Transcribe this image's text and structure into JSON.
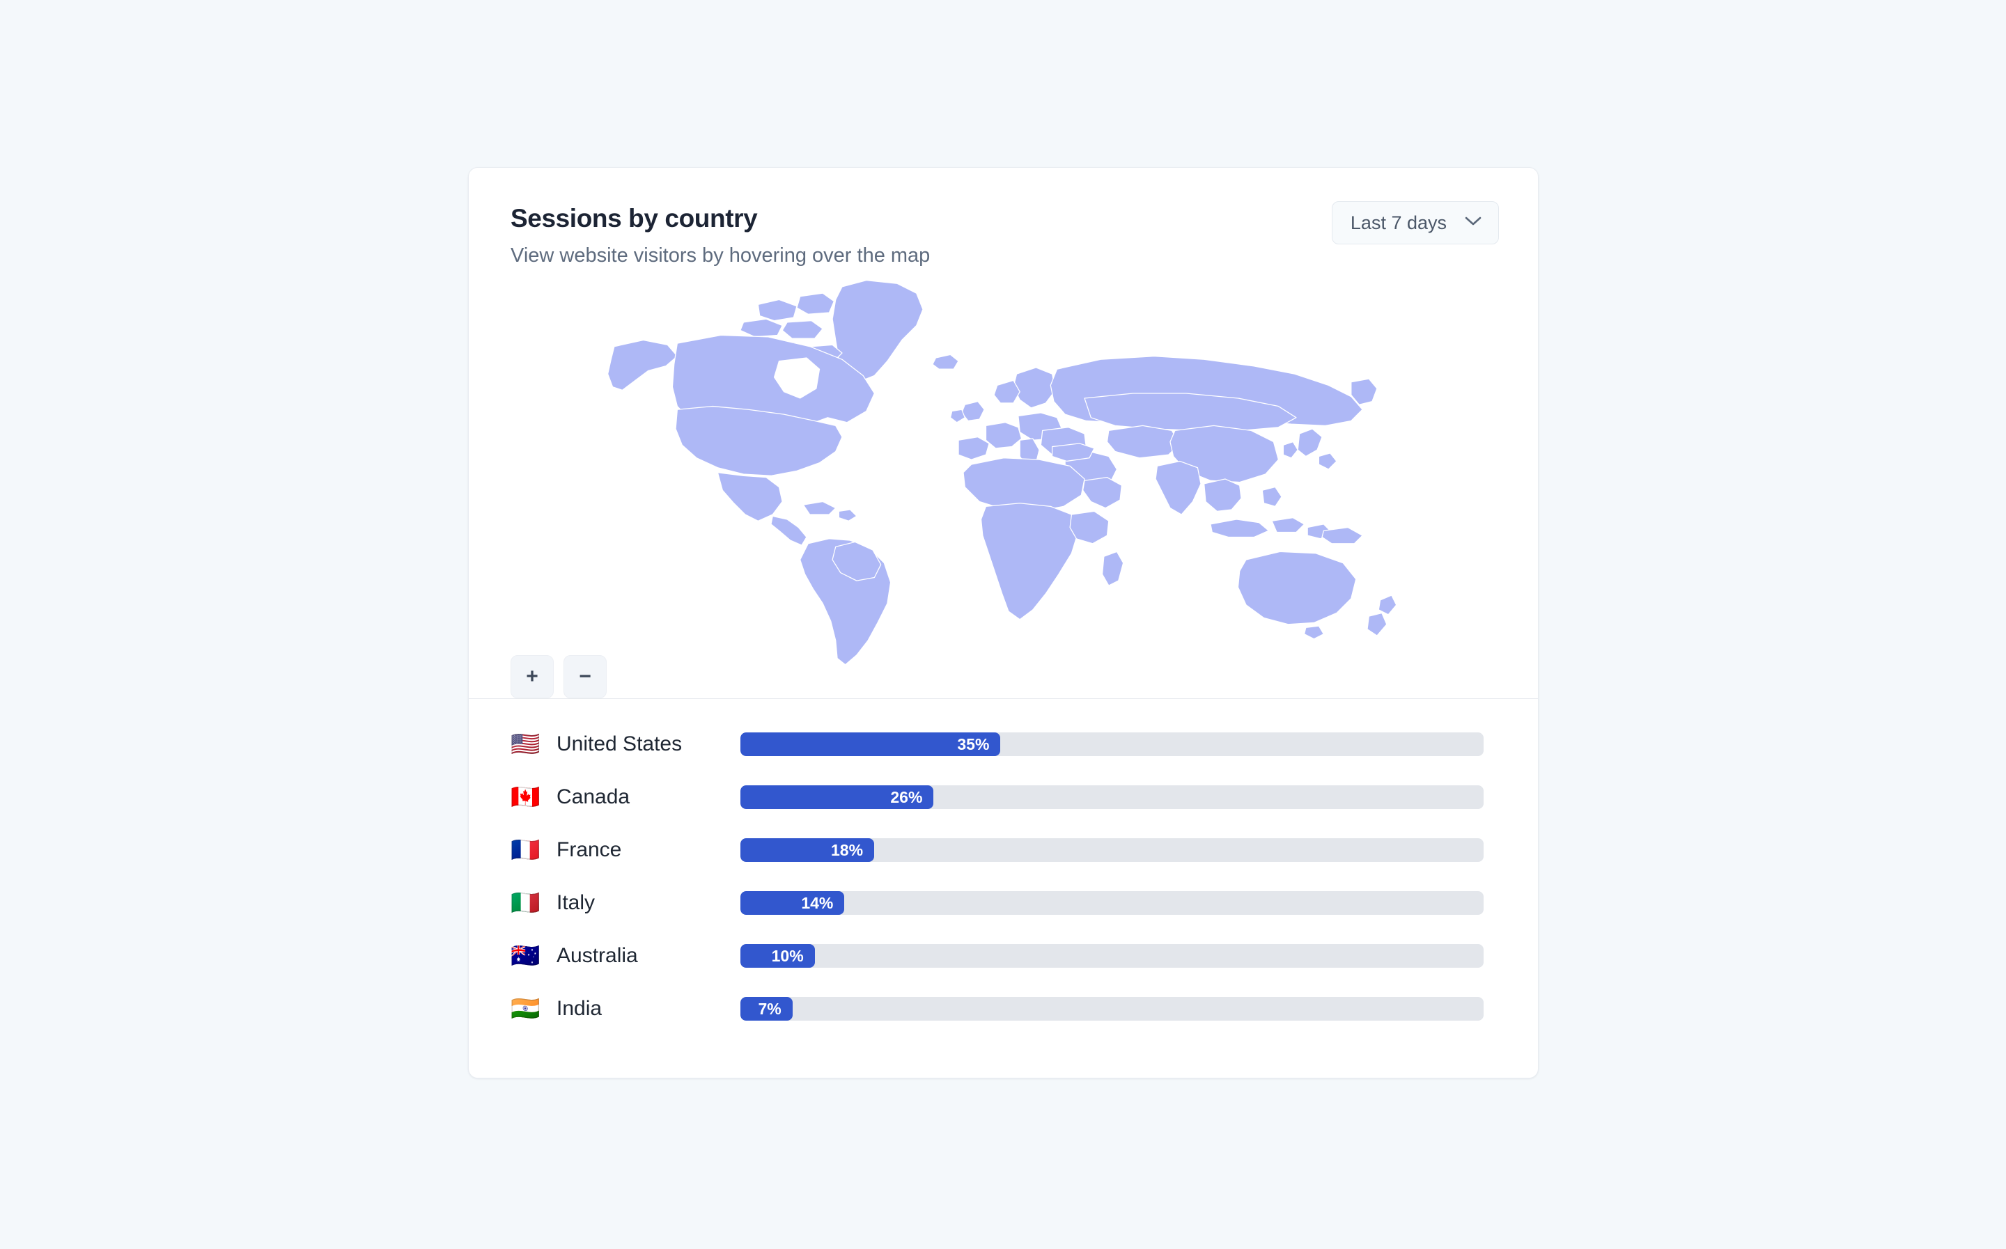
{
  "background_color": "#f4f8fb",
  "card": {
    "header": {
      "title": "Sessions by country",
      "subtitle": "View website visitors by hovering over the map"
    },
    "range_selector": {
      "selected": "Last 7 days",
      "chevron_icon": "chevron-down-icon"
    },
    "map": {
      "fill_color": "#aeb8f6",
      "border_color": "#ffffff",
      "zoom_in_label": "+",
      "zoom_out_label": "−"
    }
  },
  "chart_data": {
    "type": "bar",
    "title": "Sessions by country",
    "subtitle": "View website visitors by hovering over the map",
    "orientation": "horizontal",
    "xlabel": "",
    "ylabel": "",
    "xlim": [
      0,
      100
    ],
    "unit": "%",
    "grid": false,
    "legend": "none",
    "accent_color": "#3257ce",
    "track_color": "#e3e6eb",
    "categories": [
      "United States",
      "Canada",
      "France",
      "Italy",
      "Australia",
      "India"
    ],
    "values": [
      35,
      26,
      18,
      14,
      10,
      7
    ],
    "rows": [
      {
        "flag": "🇺🇸",
        "flag_name": "flag-united-states",
        "country": "United States",
        "value": 35,
        "label": "35%"
      },
      {
        "flag": "🇨🇦",
        "flag_name": "flag-canada",
        "country": "Canada",
        "value": 26,
        "label": "26%"
      },
      {
        "flag": "🇫🇷",
        "flag_name": "flag-france",
        "country": "France",
        "value": 18,
        "label": "18%"
      },
      {
        "flag": "🇮🇹",
        "flag_name": "flag-italy",
        "country": "Italy",
        "value": 14,
        "label": "14%"
      },
      {
        "flag": "🇦🇺",
        "flag_name": "flag-australia",
        "country": "Australia",
        "value": 10,
        "label": "10%"
      },
      {
        "flag": "🇮🇳",
        "flag_name": "flag-india",
        "country": "India",
        "value": 7,
        "label": "7%"
      }
    ]
  }
}
